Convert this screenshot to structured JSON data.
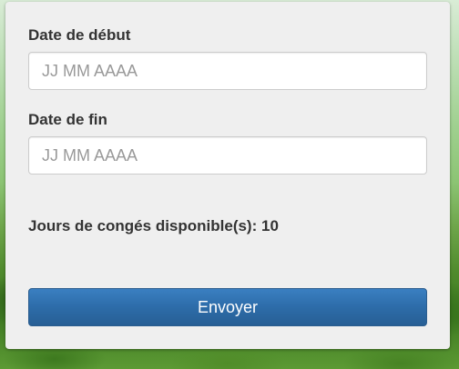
{
  "form": {
    "start_date": {
      "label": "Date de début",
      "placeholder": "JJ MM AAAA",
      "value": ""
    },
    "end_date": {
      "label": "Date de fin",
      "placeholder": "JJ MM AAAA",
      "value": ""
    },
    "leave_info": {
      "label": "Jours de congés disponible(s):",
      "days": "10"
    },
    "submit_label": "Envoyer"
  },
  "colors": {
    "button_primary": "#2d6ca9",
    "panel_background": "#efefef",
    "label_text": "#333333",
    "placeholder_text": "#999999"
  }
}
